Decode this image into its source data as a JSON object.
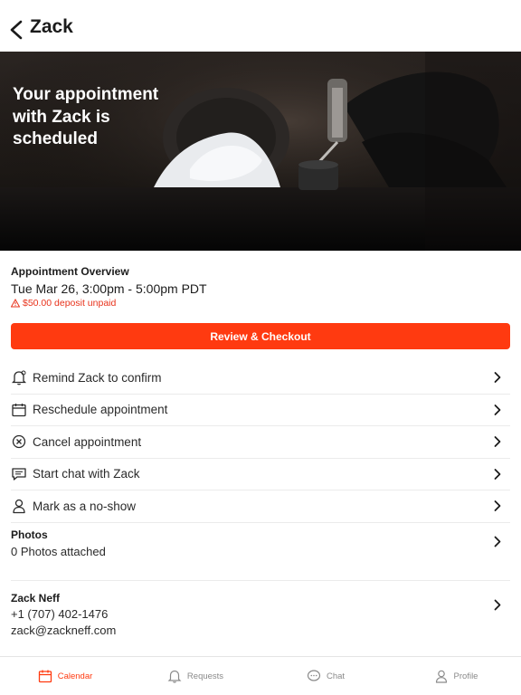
{
  "header": {
    "title": "Zack",
    "back_icon": "chevron-left-icon"
  },
  "hero": {
    "heading": "Your appointment with Zack is scheduled"
  },
  "overview": {
    "label": "Appointment Overview",
    "datetime": "Tue Mar 26, 3:00pm - 5:00pm PDT",
    "warning": "$50.00 deposit unpaid",
    "warning_color": "#e8321b"
  },
  "checkout": {
    "label": "Review & Checkout",
    "color": "#ff3a10"
  },
  "actions": [
    {
      "label": "Remind Zack to confirm",
      "icon": "bell-icon"
    },
    {
      "label": "Reschedule appointment",
      "icon": "calendar-icon"
    },
    {
      "label": "Cancel appointment",
      "icon": "cancel-circle-icon"
    },
    {
      "label": "Start chat with Zack",
      "icon": "chat-icon"
    },
    {
      "label": "Mark as a no-show",
      "icon": "person-icon"
    }
  ],
  "photos": {
    "title": "Photos",
    "subtitle": "0 Photos attached"
  },
  "contact": {
    "name": "Zack Neff",
    "phone": "+1 (707) 402-1476",
    "email": "zack@zackneff.com"
  },
  "tabbar": {
    "tabs": [
      {
        "label": "Calendar",
        "icon": "calendar-icon",
        "active": true
      },
      {
        "label": "Requests",
        "icon": "bell-icon",
        "active": false
      },
      {
        "label": "Chat",
        "icon": "chat-icon",
        "active": false
      },
      {
        "label": "Profile",
        "icon": "person-icon",
        "active": false
      }
    ],
    "active_color": "#ff3a10"
  }
}
